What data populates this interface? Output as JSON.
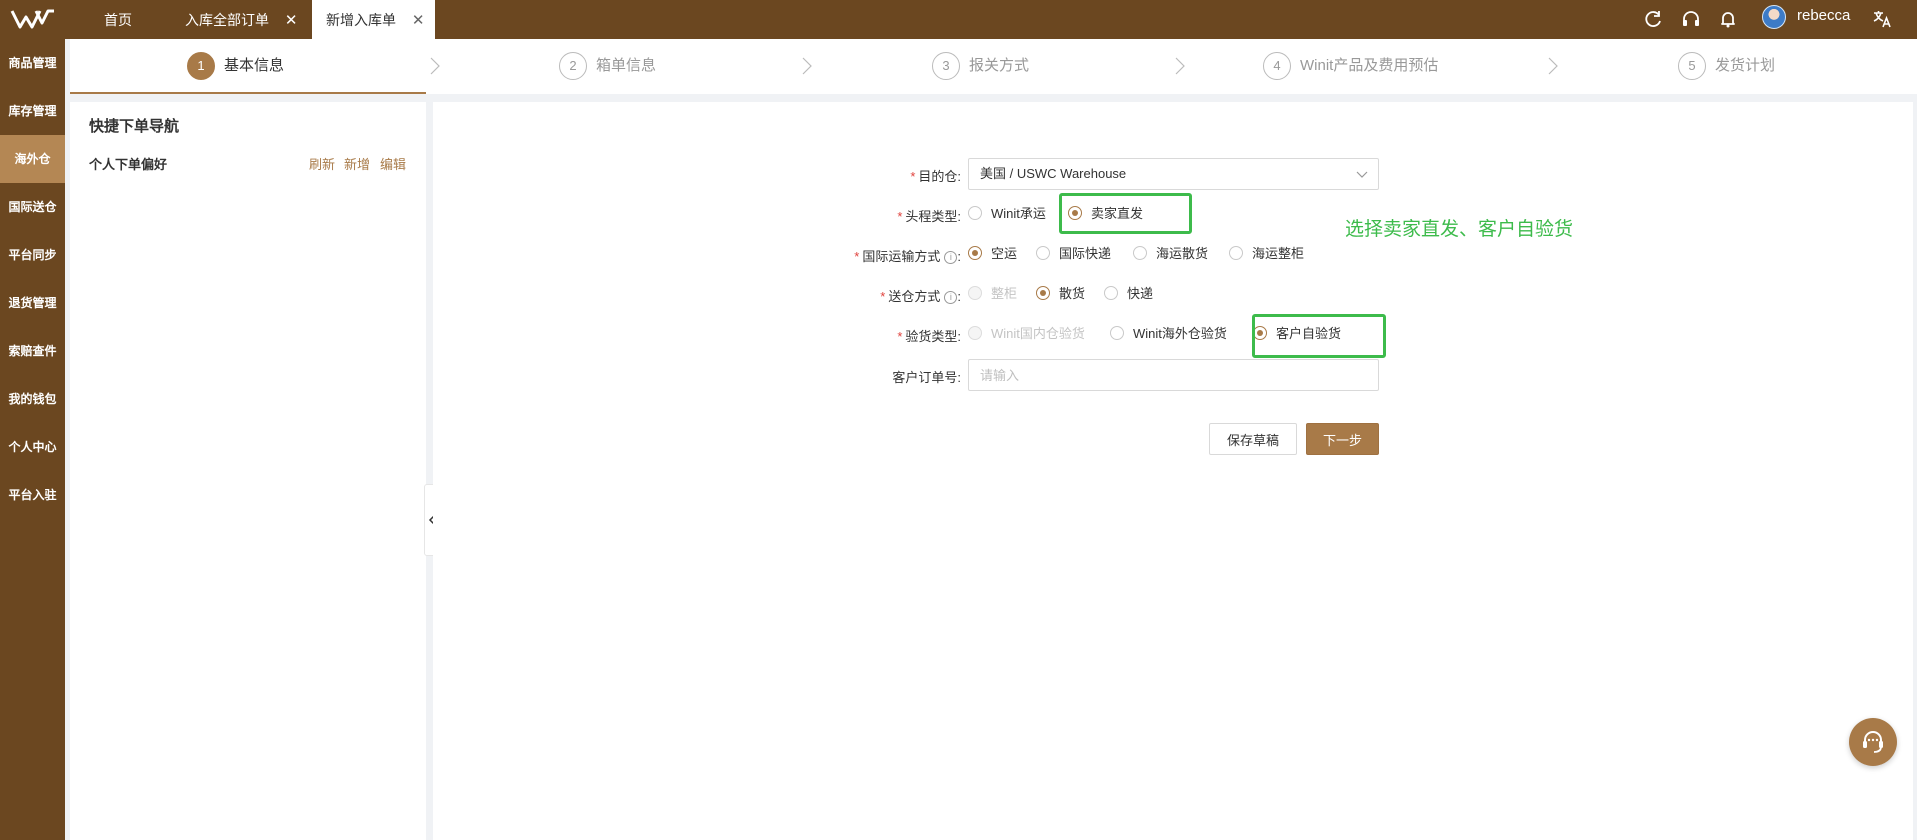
{
  "topbar": {
    "logo_icon": "winit-logo-icon",
    "tabs": [
      {
        "label": "首页"
      },
      {
        "label": "入库全部订单",
        "close": "✕"
      },
      {
        "label": "新增入库单",
        "close": "✕"
      }
    ],
    "icons": [
      "refresh-icon",
      "headset-icon",
      "bell-icon",
      "translate-icon"
    ],
    "username": "rebecca"
  },
  "sidebar": {
    "items": [
      {
        "label": "商品管理"
      },
      {
        "label": "库存管理"
      },
      {
        "label": "海外仓"
      },
      {
        "label": "国际送仓"
      },
      {
        "label": "平台同步"
      },
      {
        "label": "退货管理"
      },
      {
        "label": "索赔查件"
      },
      {
        "label": "我的钱包"
      },
      {
        "label": "个人中心"
      },
      {
        "label": "平台入驻"
      }
    ],
    "active_index": 2
  },
  "steps": [
    {
      "num": "1",
      "label": "基本信息"
    },
    {
      "num": "2",
      "label": "箱单信息"
    },
    {
      "num": "3",
      "label": "报关方式"
    },
    {
      "num": "4",
      "label": "Winit产品及费用预估"
    },
    {
      "num": "5",
      "label": "发货计划"
    }
  ],
  "left_panel": {
    "title": "快捷下单导航",
    "subtitle": "个人下单偏好",
    "links": {
      "refresh": "刷新",
      "add": "新增",
      "edit": "编辑"
    }
  },
  "form": {
    "warehouse": {
      "required": "*",
      "label": "目的仓:",
      "value": "美国 / USWC Warehouse"
    },
    "first_leg": {
      "required": "*",
      "label": "头程类型:",
      "options": [
        "Winit承运",
        "卖家直发"
      ],
      "selected": "卖家直发"
    },
    "intl_transport": {
      "required": "*",
      "label": "国际运输方式",
      "info": "i",
      "colon": ":",
      "options": [
        "空运",
        "国际快递",
        "海运散货",
        "海运整柜"
      ],
      "selected": "空运"
    },
    "delivery": {
      "required": "*",
      "label": "送仓方式",
      "info": "i",
      "colon": ":",
      "options": [
        "整柜",
        "散货",
        "快递"
      ],
      "selected": "散货",
      "disabled": [
        "整柜"
      ]
    },
    "inspection": {
      "required": "*",
      "label": "验货类型:",
      "options": [
        "Winit国内仓验货",
        "Winit海外仓验货",
        "客户自验货"
      ],
      "selected": "客户自验货",
      "disabled": [
        "Winit国内仓验货"
      ]
    },
    "customer_order": {
      "label": "客户订单号:",
      "placeholder": "请输入"
    },
    "buttons": {
      "save_draft": "保存草稿",
      "next": "下一步"
    }
  },
  "annotation": {
    "text": "选择卖家直发、客户自验货",
    "color": "#3dbb4b"
  },
  "colors": {
    "brand_dark": "#6b4720",
    "accent": "#a87a48",
    "sidebar_active": "#b48754",
    "required": "#e0413c"
  },
  "help_icon": "customer-service-icon"
}
